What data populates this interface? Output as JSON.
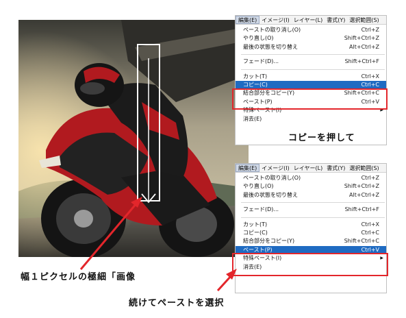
{
  "annotations": {
    "copy_note": "コピーを押して",
    "strip_note": "幅１ピクセルの極細「画像",
    "paste_note": "続けてペーストを選択"
  },
  "colors": {
    "highlight": "#1f6bc2",
    "annotation_red": "#e3262b",
    "motorcycle_red": "#b11a1f"
  },
  "menu_top": {
    "menubar": [
      "編集(E)",
      "イメージ(I)",
      "レイヤー(L)",
      "書式(Y)",
      "選択範囲(S)"
    ],
    "items": [
      {
        "label": "ペーストの取り消し(O)",
        "shortcut": "Ctrl+Z"
      },
      {
        "label": "やり直し(O)",
        "shortcut": "Shift+Ctrl+Z"
      },
      {
        "label": "最後の状態を切り替え",
        "shortcut": "Alt+Ctrl+Z"
      },
      {
        "label": "フェード(D)...",
        "shortcut": "Shift+Ctrl+F"
      },
      {
        "label": "カット(T)",
        "shortcut": "Ctrl+X"
      },
      {
        "label": "コピー(C)",
        "shortcut": "Ctrl+C"
      },
      {
        "label": "結合部分をコピー(Y)",
        "shortcut": "Shift+Ctrl+C"
      },
      {
        "label": "ペースト(P)",
        "shortcut": "Ctrl+V"
      },
      {
        "label": "特殊ペースト(I)",
        "shortcut": ""
      },
      {
        "label": "消去(E)",
        "shortcut": ""
      }
    ]
  },
  "menu_bottom": {
    "menubar": [
      "編集(E)",
      "イメージ(I)",
      "レイヤー(L)",
      "書式(Y)",
      "選択範囲(S)"
    ],
    "items": [
      {
        "label": "ペーストの取り消し(O)",
        "shortcut": "Ctrl+Z"
      },
      {
        "label": "やり直し(O)",
        "shortcut": "Shift+Ctrl+Z"
      },
      {
        "label": "最後の状態を切り替え",
        "shortcut": "Alt+Ctrl+Z"
      },
      {
        "label": "フェード(D)...",
        "shortcut": "Shift+Ctrl+F"
      },
      {
        "label": "カット(T)",
        "shortcut": "Ctrl+X"
      },
      {
        "label": "コピー(C)",
        "shortcut": "Ctrl+C"
      },
      {
        "label": "結合部分をコピー(Y)",
        "shortcut": "Shift+Ctrl+C"
      },
      {
        "label": "ペースト(P)",
        "shortcut": "Ctrl+V"
      },
      {
        "label": "特殊ペースト(I)",
        "shortcut": ""
      },
      {
        "label": "消去(E)",
        "shortcut": ""
      }
    ]
  }
}
